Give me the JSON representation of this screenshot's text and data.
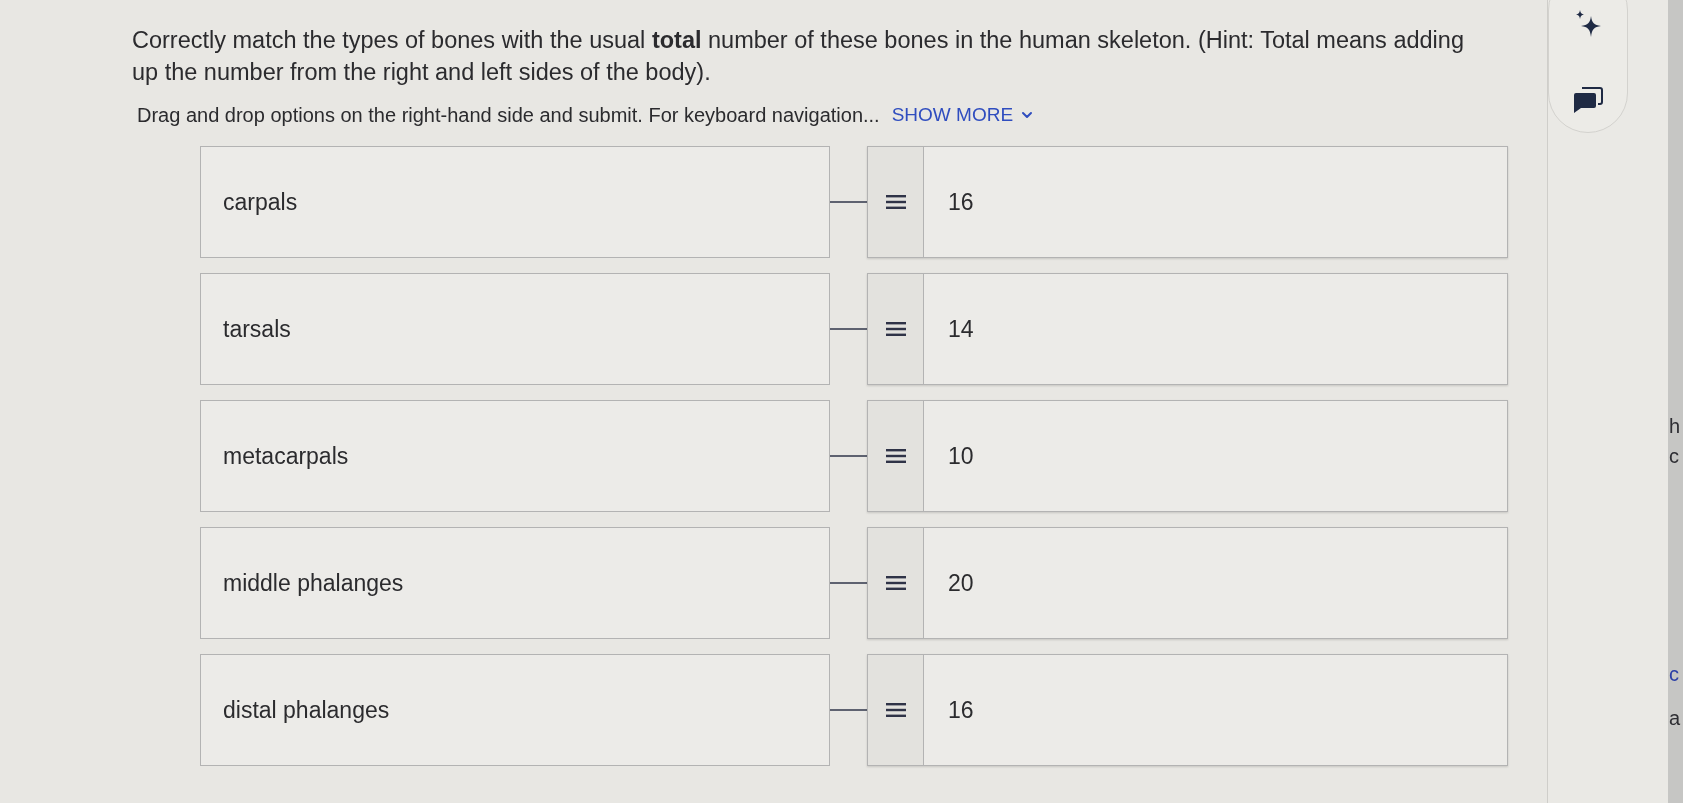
{
  "question": {
    "text": "Correctly match the types of bones with the usual **total** number of these bones in the human skeleton. (Hint: Total means adding up the number from the right and left sides of the body)."
  },
  "instructions": {
    "text": "Drag and drop options on the right-hand side and submit. For keyboard navigation...",
    "link": "SHOW MORE"
  },
  "pairs": [
    {
      "prompt": "carpals",
      "answer": "16"
    },
    {
      "prompt": "tarsals",
      "answer": "14"
    },
    {
      "prompt": "metacarpals",
      "answer": "10"
    },
    {
      "prompt": "middle phalanges",
      "answer": "20"
    },
    {
      "prompt": "distal phalanges",
      "answer": "16"
    }
  ],
  "side_rail": {
    "buttons": [
      {
        "kind": "sparkle"
      },
      {
        "kind": "chat"
      }
    ]
  },
  "background_fragments": [
    {
      "text": "h",
      "color": "#2e2e33"
    },
    {
      "text": "c",
      "color": "#2e2e33"
    },
    {
      "text": "c",
      "color": "#2b3fa6"
    },
    {
      "text": "a",
      "color": "#2e2e33"
    }
  ]
}
